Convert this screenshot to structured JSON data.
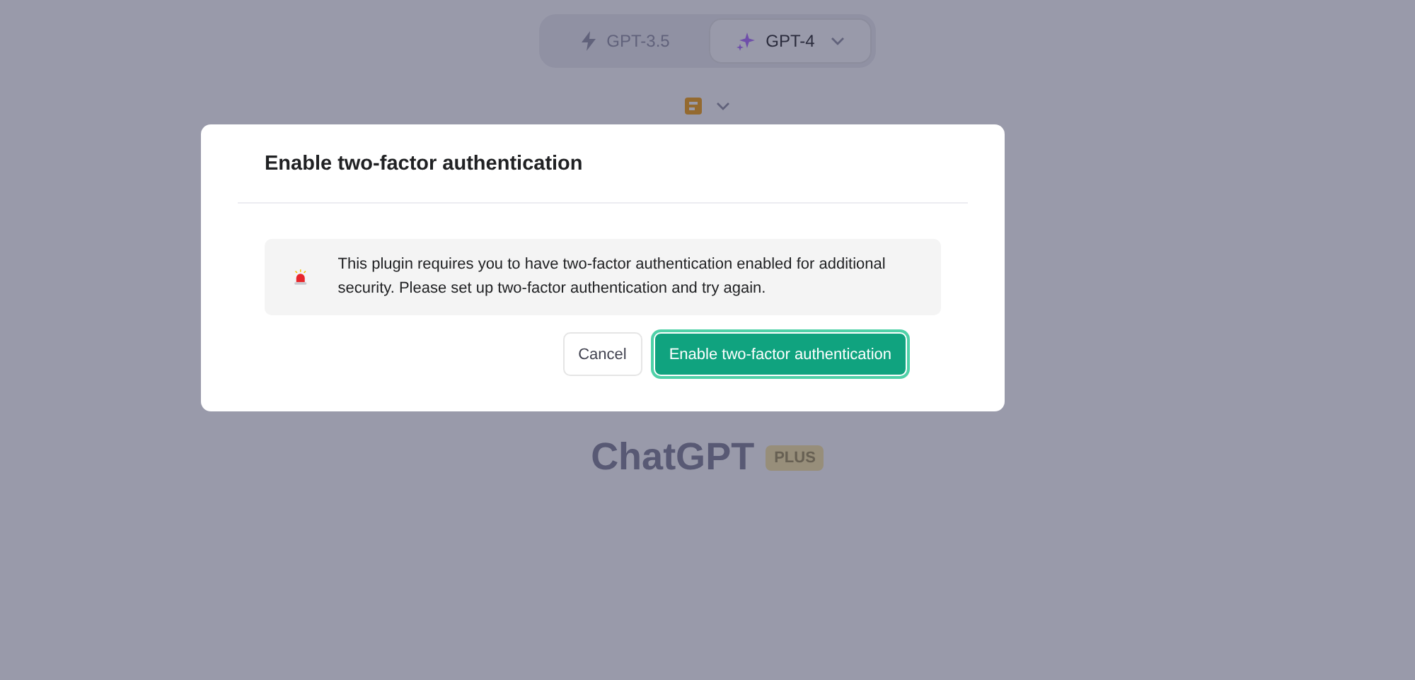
{
  "model_switcher": [
    {
      "label": "GPT-3.5",
      "selected": false
    },
    {
      "label": "GPT-4",
      "selected": true
    }
  ],
  "logo": {
    "title": "ChatGPT",
    "badge": "PLUS"
  },
  "dialog": {
    "title": "Enable two-factor authentication",
    "message": "This plugin requires you to have two-factor authentication enabled for additional security. Please set up two-factor authentication and try again.",
    "buttons": [
      {
        "label": "Cancel",
        "kind": "secondary"
      },
      {
        "label": "Enable two-factor authentication",
        "kind": "primary"
      }
    ]
  }
}
